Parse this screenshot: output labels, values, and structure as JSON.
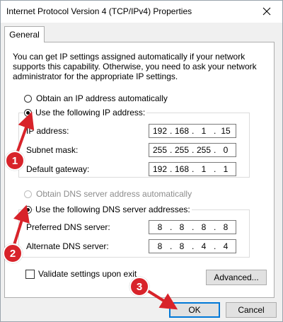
{
  "window": {
    "title": "Internet Protocol Version 4 (TCP/IPv4) Properties",
    "close_icon": "close-icon"
  },
  "tabs": [
    {
      "label": "General"
    }
  ],
  "description": "You can get IP settings assigned automatically if your network supports this capability. Otherwise, you need to ask your network administrator for the appropriate IP settings.",
  "ip_section": {
    "obtain_auto_label": "Obtain an IP address automatically",
    "use_following_label": "Use the following IP address:",
    "selected": "use_following",
    "fields": [
      {
        "label": "IP address:",
        "octets": [
          "192",
          "168",
          "1",
          "15"
        ]
      },
      {
        "label": "Subnet mask:",
        "octets": [
          "255",
          "255",
          "255",
          "0"
        ]
      },
      {
        "label": "Default gateway:",
        "octets": [
          "192",
          "168",
          "1",
          "1"
        ]
      }
    ]
  },
  "dns_section": {
    "obtain_auto_label": "Obtain DNS server address automatically",
    "use_following_label": "Use the following DNS server addresses:",
    "selected": "use_following",
    "fields": [
      {
        "label": "Preferred DNS server:",
        "octets": [
          "8",
          "8",
          "8",
          "8"
        ]
      },
      {
        "label": "Alternate DNS server:",
        "octets": [
          "8",
          "8",
          "4",
          "4"
        ]
      }
    ]
  },
  "validate_label": "Validate settings upon exit",
  "validate_checked": false,
  "advanced_button": "Advanced...",
  "ok_button": "OK",
  "cancel_button": "Cancel",
  "badges": [
    "1",
    "2",
    "3"
  ],
  "colors": {
    "badge": "#d8232a",
    "accent": "#0078d7"
  }
}
